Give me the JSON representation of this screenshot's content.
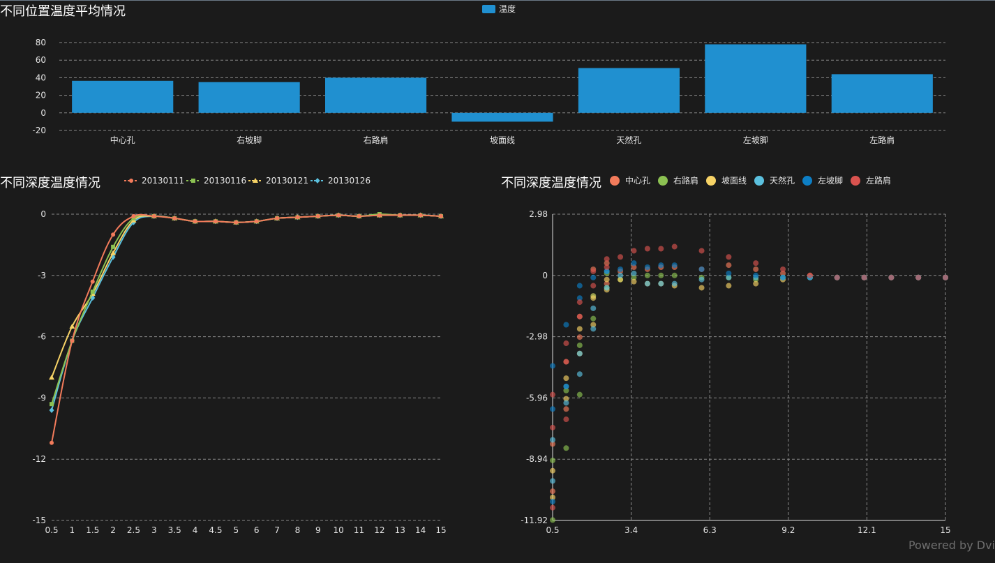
{
  "watermark": "Powered by Dvi",
  "chart_data": [
    {
      "id": "bar",
      "type": "bar",
      "title": "不同位置温度平均情况",
      "legend": [
        "温度"
      ],
      "categories": [
        "中心孔",
        "右坡脚",
        "右路肩",
        "坡面线",
        "天然孔",
        "左坡脚",
        "左路肩"
      ],
      "series": [
        {
          "name": "温度",
          "values": [
            36.5,
            35,
            40,
            -10,
            51,
            78,
            44
          ]
        }
      ],
      "ylim": [
        -20,
        80
      ],
      "yticks": [
        -20,
        0,
        20,
        40,
        60,
        80
      ],
      "color": "#2090d0",
      "grid": true
    },
    {
      "id": "line",
      "type": "line",
      "title": "不同深度温度情况",
      "x": [
        0.5,
        1,
        1.5,
        2,
        2.5,
        3,
        3.5,
        4,
        4.5,
        5,
        6,
        7,
        8,
        9,
        10,
        11,
        12,
        13,
        14,
        15
      ],
      "ylim": [
        -15,
        0
      ],
      "yticks": [
        -15,
        -12,
        -9,
        -6,
        -3,
        0
      ],
      "series": [
        {
          "name": "20130111",
          "color": "#f27b5b",
          "marker": "circle",
          "values": [
            -11.2,
            -6.2,
            -3.3,
            -1.0,
            -0.1,
            -0.1,
            -0.2,
            -0.35,
            -0.35,
            -0.4,
            -0.35,
            -0.2,
            -0.15,
            -0.1,
            -0.05,
            -0.1,
            -0.05,
            -0.05,
            -0.05,
            -0.1
          ]
        },
        {
          "name": "20130116",
          "color": "#8cc152",
          "marker": "square",
          "values": [
            -9.3,
            -6.2,
            -3.8,
            -1.6,
            -0.2,
            -0.1,
            -0.2,
            -0.35,
            -0.35,
            -0.4,
            -0.35,
            -0.2,
            -0.15,
            -0.1,
            -0.05,
            -0.1,
            0.0,
            -0.05,
            -0.05,
            -0.1
          ]
        },
        {
          "name": "20130121",
          "color": "#f7d366",
          "marker": "triangle",
          "values": [
            -8.0,
            -5.5,
            -3.9,
            -1.9,
            -0.3,
            -0.1,
            -0.2,
            -0.35,
            -0.35,
            -0.4,
            -0.35,
            -0.2,
            -0.15,
            -0.1,
            -0.05,
            -0.1,
            -0.05,
            -0.05,
            -0.05,
            -0.1
          ]
        },
        {
          "name": "20130126",
          "color": "#5bc0de",
          "marker": "diamond",
          "values": [
            -9.6,
            -6.2,
            -4.1,
            -2.1,
            -0.4,
            -0.1,
            -0.2,
            -0.35,
            -0.35,
            -0.4,
            -0.35,
            -0.2,
            -0.15,
            -0.1,
            -0.05,
            -0.1,
            -0.05,
            -0.05,
            -0.05,
            -0.1
          ]
        }
      ],
      "xticks": [
        "0.5",
        "1",
        "1.5",
        "2",
        "2.5",
        "3",
        "3.5",
        "4",
        "4.5",
        "5",
        "6",
        "7",
        "8",
        "9",
        "10",
        "11",
        "12",
        "13",
        "14",
        "15"
      ],
      "grid": true
    },
    {
      "id": "scatter",
      "type": "scatter",
      "title": "不同深度温度情况",
      "xlim": [
        0.5,
        15
      ],
      "xticks": [
        "0.5",
        "3.4",
        "6.3",
        "9.2",
        "12.1",
        "15"
      ],
      "ylim": [
        -11.92,
        2.98
      ],
      "yticks": [
        "-11.92",
        "-8.94",
        "-5.96",
        "-2.98",
        "0",
        "2.98"
      ],
      "grid": true,
      "series": [
        {
          "name": "中心孔",
          "color": "#f27b5b",
          "points": [
            [
              0.5,
              -10.5
            ],
            [
              0.5,
              -8.2
            ],
            [
              1,
              -6.5
            ],
            [
              1,
              -4.2
            ],
            [
              1.5,
              -3.0
            ],
            [
              1.5,
              -2.0
            ],
            [
              2,
              -1.0
            ],
            [
              2,
              0.3
            ],
            [
              2.5,
              -0.4
            ],
            [
              2.5,
              0.6
            ],
            [
              3,
              0.2
            ],
            [
              3.5,
              0.4
            ],
            [
              4,
              0.3
            ],
            [
              4.5,
              0.4
            ],
            [
              5,
              0.4
            ],
            [
              6,
              0.3
            ],
            [
              7,
              0.5
            ],
            [
              8,
              0.3
            ],
            [
              9,
              0.1
            ],
            [
              10,
              0.0
            ],
            [
              11,
              -0.1
            ],
            [
              12,
              -0.1
            ],
            [
              13,
              -0.1
            ],
            [
              14,
              -0.1
            ],
            [
              15,
              -0.1
            ]
          ]
        },
        {
          "name": "右路肩",
          "color": "#8cc152",
          "points": [
            [
              0.5,
              -11.9
            ],
            [
              0.5,
              -9.0
            ],
            [
              1,
              -8.4
            ],
            [
              1,
              -5.6
            ],
            [
              1.5,
              -5.8
            ],
            [
              1.5,
              -3.4
            ],
            [
              2,
              -2.1
            ],
            [
              2,
              -1.0
            ],
            [
              2.5,
              -0.6
            ],
            [
              2.5,
              0.1
            ],
            [
              3,
              -0.2
            ],
            [
              3.5,
              -0.1
            ],
            [
              4,
              0.0
            ],
            [
              4.5,
              0.0
            ],
            [
              5,
              0.0
            ],
            [
              6,
              -0.1
            ],
            [
              7,
              -0.1
            ],
            [
              8,
              -0.2
            ],
            [
              9,
              -0.1
            ],
            [
              10,
              -0.1
            ],
            [
              11,
              -0.1
            ],
            [
              12,
              -0.1
            ],
            [
              13,
              -0.1
            ],
            [
              14,
              -0.1
            ],
            [
              15,
              -0.1
            ]
          ]
        },
        {
          "name": "坡面线",
          "color": "#f7d366",
          "points": [
            [
              0.5,
              -10.8
            ],
            [
              0.5,
              -9.5
            ],
            [
              1,
              -6.0
            ],
            [
              1,
              -5.0
            ],
            [
              1.5,
              -3.8
            ],
            [
              1.5,
              -2.6
            ],
            [
              2,
              -2.4
            ],
            [
              2,
              -1.1
            ],
            [
              2.5,
              -0.7
            ],
            [
              2.5,
              -0.2
            ],
            [
              3,
              -0.2
            ],
            [
              3.5,
              -0.3
            ],
            [
              4,
              -0.4
            ],
            [
              4.5,
              -0.4
            ],
            [
              5,
              -0.5
            ],
            [
              6,
              -0.6
            ],
            [
              7,
              -0.5
            ],
            [
              8,
              -0.4
            ],
            [
              9,
              -0.2
            ],
            [
              10,
              -0.1
            ],
            [
              11,
              -0.1
            ],
            [
              12,
              -0.1
            ],
            [
              13,
              -0.1
            ],
            [
              14,
              -0.1
            ],
            [
              15,
              -0.1
            ]
          ]
        },
        {
          "name": "天然孔",
          "color": "#5bc0de",
          "points": [
            [
              0.5,
              -10.0
            ],
            [
              0.5,
              -8.0
            ],
            [
              1,
              -6.2
            ],
            [
              1,
              -5.4
            ],
            [
              1.5,
              -4.8
            ],
            [
              1.5,
              -3.8
            ],
            [
              2,
              -2.6
            ],
            [
              2,
              -1.6
            ],
            [
              2.5,
              -0.6
            ],
            [
              2.5,
              0.2
            ],
            [
              3,
              0.0
            ],
            [
              3.5,
              0.1
            ],
            [
              4,
              -0.4
            ],
            [
              4.5,
              -0.4
            ],
            [
              5,
              -0.4
            ],
            [
              6,
              -0.2
            ],
            [
              7,
              -0.1
            ],
            [
              8,
              -0.1
            ],
            [
              9,
              -0.1
            ],
            [
              10,
              -0.1
            ],
            [
              11,
              -0.1
            ],
            [
              12,
              -0.1
            ],
            [
              13,
              -0.1
            ],
            [
              14,
              -0.1
            ],
            [
              15,
              -0.1
            ]
          ]
        },
        {
          "name": "左坡脚",
          "color": "#0d7ec4",
          "points": [
            [
              0.5,
              -11.0
            ],
            [
              0.5,
              -6.5
            ],
            [
              0.5,
              -4.4
            ],
            [
              1,
              -5.4
            ],
            [
              1,
              -2.4
            ],
            [
              1.5,
              -1.1
            ],
            [
              1.5,
              -0.5
            ],
            [
              2,
              -0.1
            ],
            [
              2.5,
              0.2
            ],
            [
              3,
              0.3
            ],
            [
              3.5,
              0.6
            ],
            [
              4,
              0.4
            ],
            [
              4.5,
              0.5
            ],
            [
              5,
              0.5
            ],
            [
              6,
              0.3
            ],
            [
              7,
              0.1
            ],
            [
              8,
              0.0
            ],
            [
              9,
              -0.1
            ],
            [
              10,
              -0.1
            ],
            [
              11,
              -0.1
            ],
            [
              12,
              -0.1
            ],
            [
              13,
              -0.1
            ],
            [
              14,
              -0.1
            ],
            [
              15,
              -0.1
            ]
          ]
        },
        {
          "name": "左路肩",
          "color": "#d9534f",
          "points": [
            [
              0.5,
              -11.3
            ],
            [
              0.5,
              -7.4
            ],
            [
              0.5,
              -5.8
            ],
            [
              1,
              -7.0
            ],
            [
              1,
              -4.2
            ],
            [
              1,
              -3.3
            ],
            [
              1.5,
              -2.0
            ],
            [
              1.5,
              -1.3
            ],
            [
              2,
              -0.5
            ],
            [
              2,
              0.2
            ],
            [
              2.5,
              0.4
            ],
            [
              2.5,
              0.8
            ],
            [
              3,
              0.9
            ],
            [
              3.5,
              1.2
            ],
            [
              4,
              1.3
            ],
            [
              4.5,
              1.3
            ],
            [
              5,
              1.4
            ],
            [
              6,
              1.2
            ],
            [
              7,
              0.9
            ],
            [
              8,
              0.6
            ],
            [
              9,
              0.3
            ],
            [
              10,
              0.0
            ],
            [
              11,
              -0.1
            ],
            [
              12,
              -0.1
            ],
            [
              13,
              -0.1
            ],
            [
              14,
              -0.1
            ],
            [
              15,
              -0.1
            ]
          ]
        }
      ]
    }
  ]
}
